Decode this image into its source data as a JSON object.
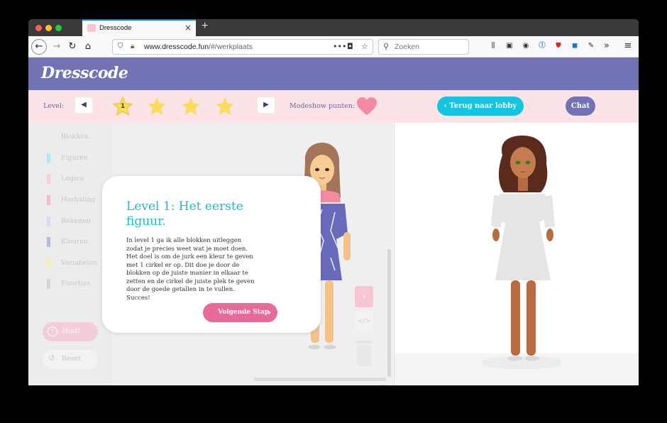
{
  "browser": {
    "tab_title": "Dresscode",
    "tab_close": "×",
    "new_tab": "+",
    "url_domain": "www.dresscode.fun",
    "url_path": "/#/werkplaats",
    "url_more": "•••",
    "search_placeholder": "Zoeken",
    "overflow": "»",
    "menu": "≡"
  },
  "site": {
    "logo": "Dresscode"
  },
  "levelbar": {
    "level_label": "Level:",
    "current_level": "1",
    "stars_total": 4,
    "points_label": "Modeshow punten:",
    "lobby_button": "Terug naar lobby",
    "chat_button": "Chat"
  },
  "categories": [
    {
      "label": "Blokken",
      "color": ""
    },
    {
      "label": "Figuren",
      "color": "#b8e6f0"
    },
    {
      "label": "Logica",
      "color": "#f6cdd8"
    },
    {
      "label": "Herhaling",
      "color": "#f4bccb"
    },
    {
      "label": "Rekenen",
      "color": "#d9dbf1"
    },
    {
      "label": "Kleuren",
      "color": "#b8b9de"
    },
    {
      "label": "Variabelen",
      "color": "#f7ebb6"
    },
    {
      "label": "Functies",
      "color": "#d4d4d4"
    }
  ],
  "workspace": {
    "hint_label": "Hint!",
    "hint_icon": "!",
    "reset_label": "Reset"
  },
  "dialog": {
    "title": "Level 1: Het eerste figuur.",
    "body": "In level 1 ga ik alle blokken uitleggen zodat je precies weet wat je moet doen. Het doel is om de jurk een kleur te geven met 1 cirkel er op. Dit doe je door de blokken op de juiste manier in elkaar te zetten en de cirkel de juiste plek te geven door de goede getallen in te vullen. Succes!",
    "next_button": "Volgende Stap"
  },
  "colors": {
    "header": "#7173b5",
    "levelbar": "#fbe3e7",
    "star": "#f8dc5c",
    "lobby": "#14c4e0",
    "next": "#e66b9a",
    "title": "#18bcd6"
  }
}
